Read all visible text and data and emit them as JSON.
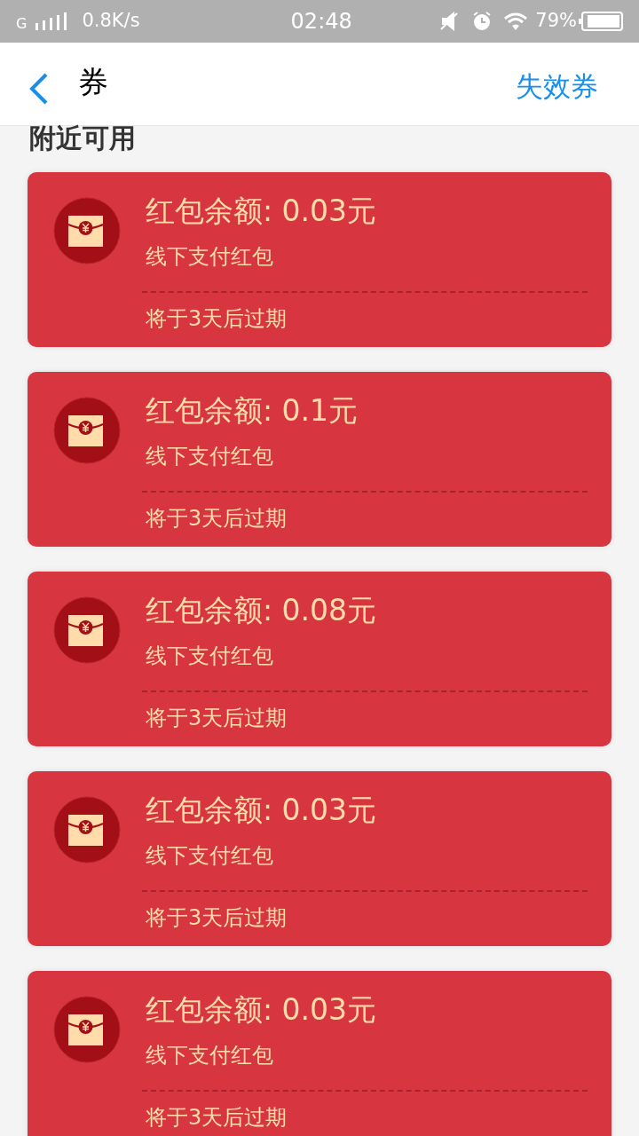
{
  "status_bar": {
    "network": "G",
    "speed": "0.8K/s",
    "time": "02:48",
    "battery": "79%"
  },
  "header": {
    "title": "券",
    "action": "失效券"
  },
  "section_title": "附近可用",
  "coupons": [
    {
      "amount": "红包余额: 0.03元",
      "type": "线下支付红包",
      "expiry": "将于3天后过期"
    },
    {
      "amount": "红包余额: 0.1元",
      "type": "线下支付红包",
      "expiry": "将于3天后过期"
    },
    {
      "amount": "红包余额: 0.08元",
      "type": "线下支付红包",
      "expiry": "将于3天后过期"
    },
    {
      "amount": "红包余额: 0.03元",
      "type": "线下支付红包",
      "expiry": "将于3天后过期"
    },
    {
      "amount": "红包余额: 0.03元",
      "type": "线下支付红包",
      "expiry": "将于3天后过期"
    }
  ]
}
